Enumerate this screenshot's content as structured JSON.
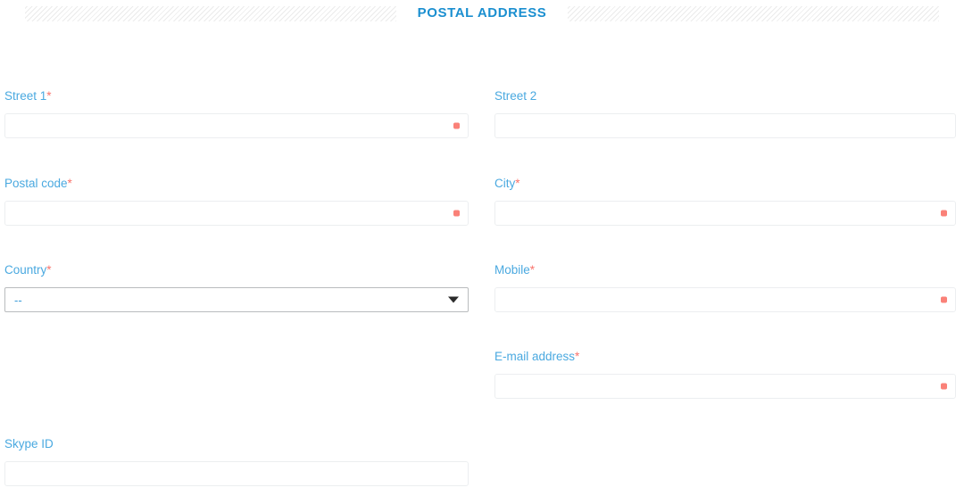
{
  "section": {
    "title": "POSTAL ADDRESS"
  },
  "colors": {
    "title_blue": "#1b8fd0",
    "label_blue": "#4aa9e0",
    "required_red": "#f9746c",
    "required_dot": "#fa8178",
    "input_border": "#eceef0",
    "select_border": "#b9bcbe",
    "stripe_gray": "#ebebeb"
  },
  "fields": {
    "street1": {
      "label": "Street 1",
      "required_marker": "*",
      "value": "",
      "placeholder": ""
    },
    "street2": {
      "label": "Street 2",
      "required_marker": "",
      "value": "",
      "placeholder": ""
    },
    "postal_code": {
      "label": "Postal code",
      "required_marker": "*",
      "value": "",
      "placeholder": ""
    },
    "city": {
      "label": "City",
      "required_marker": "*",
      "value": "",
      "placeholder": ""
    },
    "country": {
      "label": "Country",
      "required_marker": "*",
      "selected": "--",
      "options": [
        "--"
      ]
    },
    "mobile": {
      "label": "Mobile",
      "required_marker": "*",
      "value": "",
      "placeholder": ""
    },
    "email": {
      "label": "E-mail address",
      "required_marker": "*",
      "value": "",
      "placeholder": ""
    },
    "skype": {
      "label": "Skype ID",
      "required_marker": "",
      "value": "",
      "placeholder": ""
    }
  }
}
